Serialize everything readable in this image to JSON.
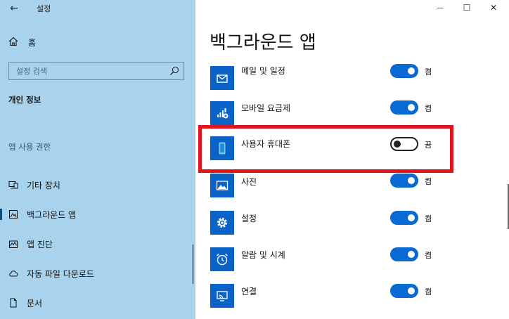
{
  "window": {
    "title": "설정",
    "minimize_glyph": "—",
    "maximize_glyph": "☐",
    "close_glyph": "✕",
    "back_glyph": "←"
  },
  "sidebar": {
    "home_label": "홈",
    "search_placeholder": "설정 검색",
    "section_header": "개인 정보",
    "subsection_header": "앱 사용 권한",
    "items": [
      {
        "label": "기타 장치",
        "icon": "devices-icon"
      },
      {
        "label": "백그라운드 앱",
        "icon": "background-apps-icon",
        "selected": true
      },
      {
        "label": "앱 진단",
        "icon": "app-diagnostics-icon"
      },
      {
        "label": "자동 파일 다운로드",
        "icon": "cloud-icon"
      },
      {
        "label": "문서",
        "icon": "document-icon"
      }
    ]
  },
  "main": {
    "title": "백그라운드 앱",
    "apps": [
      {
        "name": "메일 및 일정",
        "state": "켬",
        "on": true,
        "icon": "mail-calendar-icon"
      },
      {
        "name": "모바일 요금제",
        "state": "켬",
        "on": true,
        "icon": "mobile-plans-icon"
      },
      {
        "name": "사용자 휴대폰",
        "state": "끔",
        "on": false,
        "icon": "your-phone-icon"
      },
      {
        "name": "사진",
        "state": "켬",
        "on": true,
        "icon": "photos-icon"
      },
      {
        "name": "설정",
        "state": "켬",
        "on": true,
        "icon": "settings-gear-icon"
      },
      {
        "name": "알람 및 시계",
        "state": "켬",
        "on": true,
        "icon": "alarm-clock-icon"
      },
      {
        "name": "연결",
        "state": "켬",
        "on": true,
        "icon": "connect-icon"
      }
    ]
  },
  "colors": {
    "sidebar_bg": "#a9d3ec",
    "accent": "#0a6ad4",
    "highlight": "#e0141e"
  }
}
